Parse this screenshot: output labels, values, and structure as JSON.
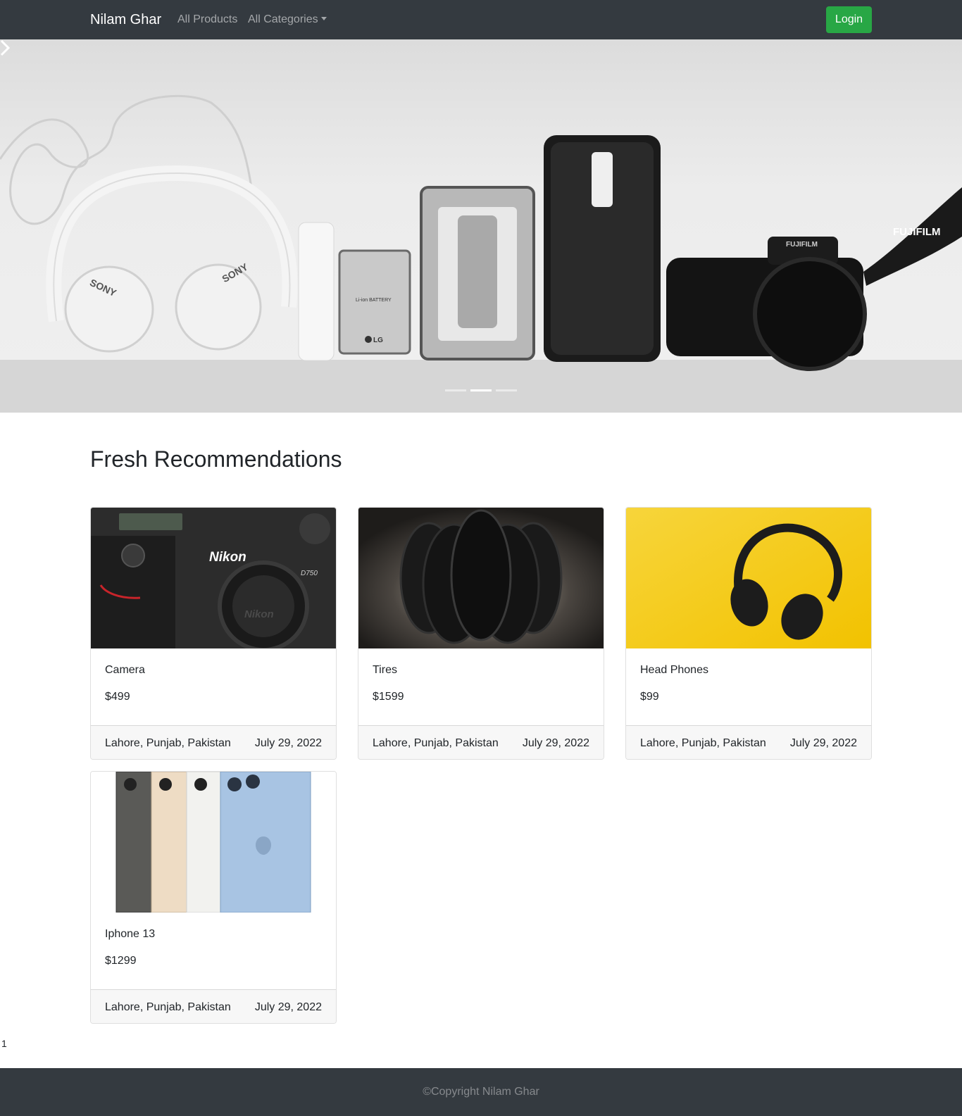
{
  "navbar": {
    "brand": "Nilam Ghar",
    "links": {
      "products": "All Products",
      "categories": "All Categories"
    },
    "login_label": "Login",
    "background": "#343a40",
    "login_color": "#28a745"
  },
  "hero": {
    "image": "electronics-flatlay-banner",
    "texts": {
      "sony_left": "SONY",
      "sony_right": "SONY",
      "battery": "Li-ion BATTERY",
      "lg": "LG",
      "fujifilm_strap": "FUJIFILM",
      "fujifilm_body": "FUJIFILM"
    },
    "active_slide": 2,
    "slide_count": 3
  },
  "section_title": "Fresh Recommendations",
  "cards": [
    {
      "name": "Camera",
      "price": "$499",
      "location": "Lahore, Punjab, Pakistan",
      "date": "July 29, 2022",
      "image": "nikon-camera-photo",
      "image_texts": {
        "brand": "Nikon",
        "model": "D750",
        "mount": "Nikon"
      }
    },
    {
      "name": "Tires",
      "price": "$1599",
      "location": "Lahore, Punjab, Pakistan",
      "date": "July 29, 2022",
      "image": "tires-photo"
    },
    {
      "name": "Head Phones",
      "price": "$99",
      "location": "Lahore, Punjab, Pakistan",
      "date": "July 29, 2022",
      "image": "headphones-on-yellow-photo"
    },
    {
      "name": "Iphone 13",
      "price": "$1299",
      "location": "Lahore, Punjab, Pakistan",
      "date": "July 29, 2022",
      "image": "iphone-13-colors-photo"
    }
  ],
  "page_number": "1",
  "footer": {
    "copyright": "©Copyright Nilam Ghar"
  }
}
